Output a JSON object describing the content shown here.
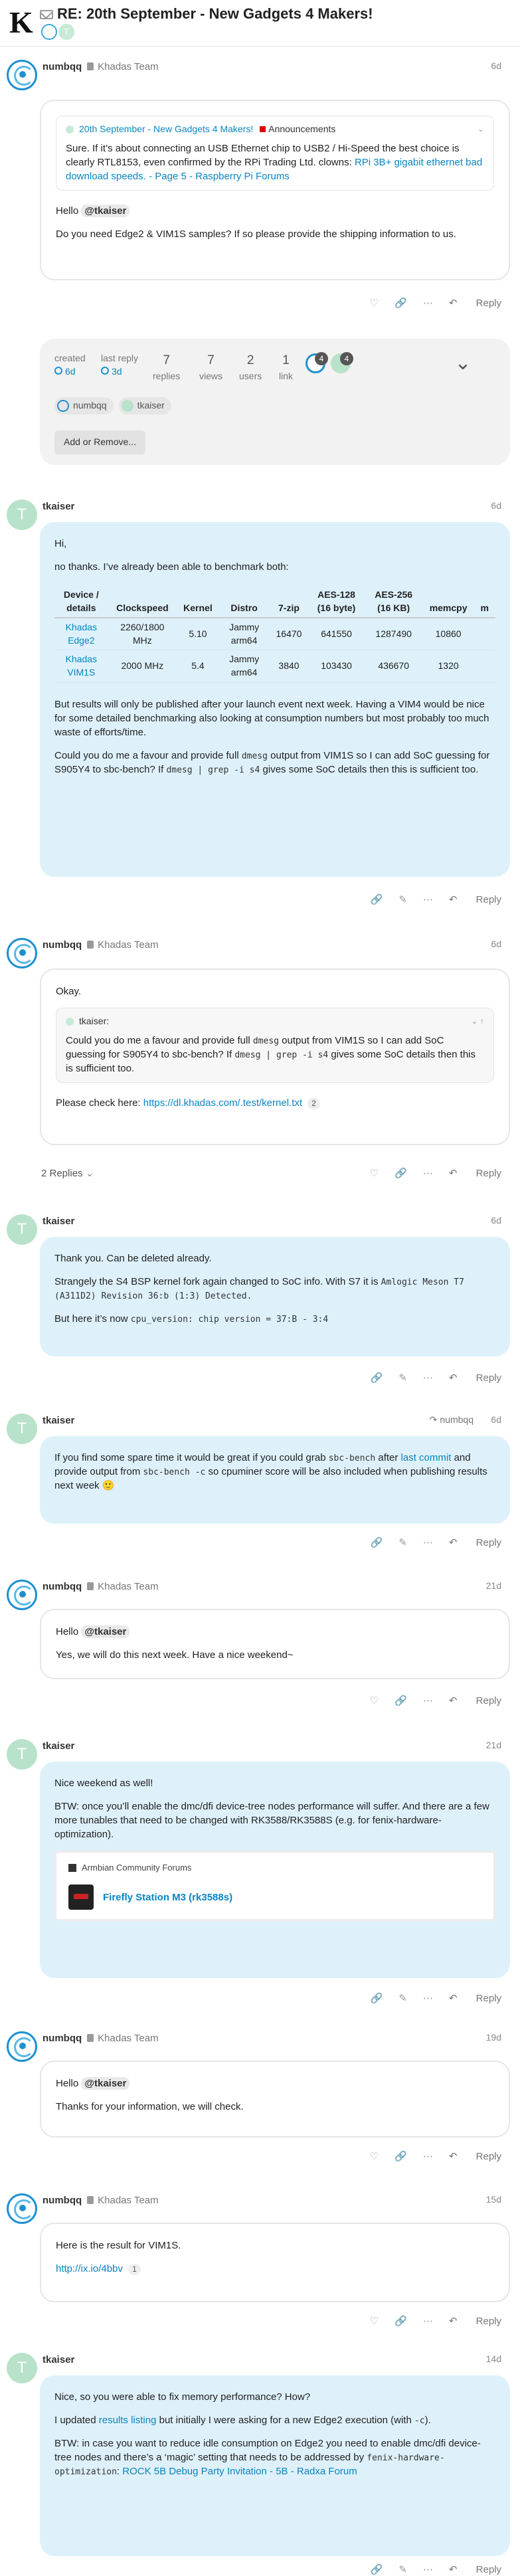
{
  "header": {
    "logo_letter": "K",
    "title": "RE: 20th September - New Gadgets 4 Makers!"
  },
  "posts": [
    {
      "username": "numbqq",
      "user_title": "Khadas Team",
      "date": "6d",
      "quote_title": "20th September - New Gadgets 4 Makers!",
      "quote_category": "Announcements",
      "quote_text": "Sure. If it’s about connecting an USB Ethernet chip to USB2 / Hi-Speed the best choice is clearly RTL8153, even confirmed by the RPi Trading Ltd. clowns:",
      "quote_link": "RPi 3B+ gigabit ethernet bad download speeds. - Page 5 - Raspberry Pi Forums",
      "hello": "Hello",
      "mention": "@tkaiser",
      "body": "Do you need Edge2 & VIM1S samples? If so please provide the shipping information to us."
    },
    {
      "username": "tkaiser",
      "avatar_letter": "T",
      "date": "6d",
      "p1": "Hi,",
      "p2": "no thanks. I’ve already been able to benchmark both:",
      "table_headers": [
        "Device / details",
        "Clockspeed",
        "Kernel",
        "Distro",
        "7-zip",
        "AES-128 (16 byte)",
        "AES-256 (16 KB)",
        "memcpy",
        "m"
      ],
      "table_rows": [
        [
          "Khadas Edge2",
          "2260/1800 MHz",
          "5.10",
          "Jammy arm64",
          "16470",
          "641550",
          "1287490",
          "10860",
          ""
        ],
        [
          "Khadas VIM1S",
          "2000 MHz",
          "5.4",
          "Jammy arm64",
          "3840",
          "103430",
          "436670",
          "1320",
          ""
        ]
      ],
      "p3": "But results will only be published after your launch event next week. Having a VIM4 would be nice for some detailed benchmarking also looking at consumption numbers but most probably too much waste of efforts/time.",
      "p4a": "Could you do me a favour and provide full",
      "p4code1": "dmesg",
      "p4b": "output from VIM1S so I can add SoC guessing for S905Y4 to sbc-bench? If",
      "p4code2": "dmesg | grep -i s4",
      "p4c": "gives some SoC details then this is sufficient too."
    },
    {
      "username": "numbqq",
      "user_title": "Khadas Team",
      "date": "6d",
      "p1": "Okay.",
      "quote_user": "tkaiser:",
      "quote_a": "Could you do me a favour and provide full",
      "quote_code1": "dmesg",
      "quote_b": "output from VIM1S so I can add SoC guessing for S905Y4 to sbc-bench? If",
      "quote_code2": "dmesg | grep -i s4",
      "quote_c": "gives some SoC details then this is sufficient too.",
      "p2": "Please check here:",
      "link": "https://dl.khadas.com/.test/kernel.txt",
      "link_count": "2",
      "replies": "2 Replies"
    },
    {
      "username": "tkaiser",
      "avatar_letter": "T",
      "date": "6d",
      "p1": "Thank you. Can be deleted already.",
      "p2": "Strangely the S4 BSP kernel fork again changed to SoC info. With S7 it is",
      "p2code": "Amlogic Meson T7 (A311D2) Revision 36:b (1:3) Detected.",
      "p3": "But here it’s now",
      "p3code": "cpu_version: chip version = 37:B - 3:4"
    },
    {
      "username": "tkaiser",
      "avatar_letter": "T",
      "date": "6d",
      "reply_to": "numbqq",
      "a": "If you find some spare time it would be great if you could grab",
      "code1": "sbc-bench",
      "b": "after",
      "link": "last commit",
      "c": "and provide output from",
      "code2": "sbc-bench -c",
      "d": "so cpuminer score will be also included when publishing results next week 🙂"
    },
    {
      "username": "numbqq",
      "user_title": "Khadas Team",
      "date": "21d",
      "hello": "Hello",
      "mention": "@tkaiser",
      "body": "Yes, we will do this next week. Have a nice weekend~"
    },
    {
      "username": "tkaiser",
      "avatar_letter": "T",
      "date": "21d",
      "p1": "Nice weekend as well!",
      "p2": "BTW: once you’ll enable the dmc/dfi device-tree nodes performance will suffer. And there are a few more tunables that need to be changed with RK3588/RK3588S (e.g. for fenix-hardware-optimization).",
      "onebox_source": "Armbian Community Forums",
      "onebox_title": "Firefly Station M3 (rk3588s)"
    },
    {
      "username": "numbqq",
      "user_title": "Khadas Team",
      "date": "19d",
      "hello": "Hello",
      "mention": "@tkaiser",
      "body": "Thanks for your information, we will check."
    },
    {
      "username": "numbqq",
      "user_title": "Khadas Team",
      "date": "15d",
      "body": "Here is the result for VIM1S.",
      "link": "http://ix.io/4bbv",
      "link_count": "1"
    },
    {
      "username": "tkaiser",
      "avatar_letter": "T",
      "date": "14d",
      "p1": "Nice, so you were able to fix memory performance? How?",
      "p2a": "I updated",
      "p2link": "results listing",
      "p2b": "but initially I were asking for a new Edge2 execution (with",
      "p2code": "-c",
      "p2c": ").",
      "p3a": "BTW: in case you want to reduce idle consumption on Edge2 you need to enable dmc/dfi device-tree nodes and there’s a ‘magic’ setting that needs to be addressed by",
      "p3code": "fenix-hardware-optimization",
      "p3b": ":",
      "p3link": "ROCK 5B Debug Party Invitation - 5B - Radxa Forum"
    }
  ],
  "topic_meta": {
    "created_label": "created",
    "created_value": "6d",
    "last_reply_label": "last reply",
    "last_reply_value": "3d",
    "replies_count": "7",
    "replies_label": "replies",
    "views_count": "7",
    "views_label": "views",
    "users_count": "2",
    "users_label": "users",
    "link_count": "1",
    "link_label": "link",
    "avatar_badge_1": "4",
    "avatar_badge_2": "4",
    "participant_1": "numbqq",
    "participant_2": "tkaiser",
    "add_remove_button": "Add or Remove..."
  },
  "actions": {
    "reply_label": "Reply"
  },
  "colors": {
    "link": "#0a84c1",
    "bubble_blue": "#def1fb",
    "team_avatar": "#1e90d0",
    "tkaiser_avatar": "#b8e2c9"
  }
}
